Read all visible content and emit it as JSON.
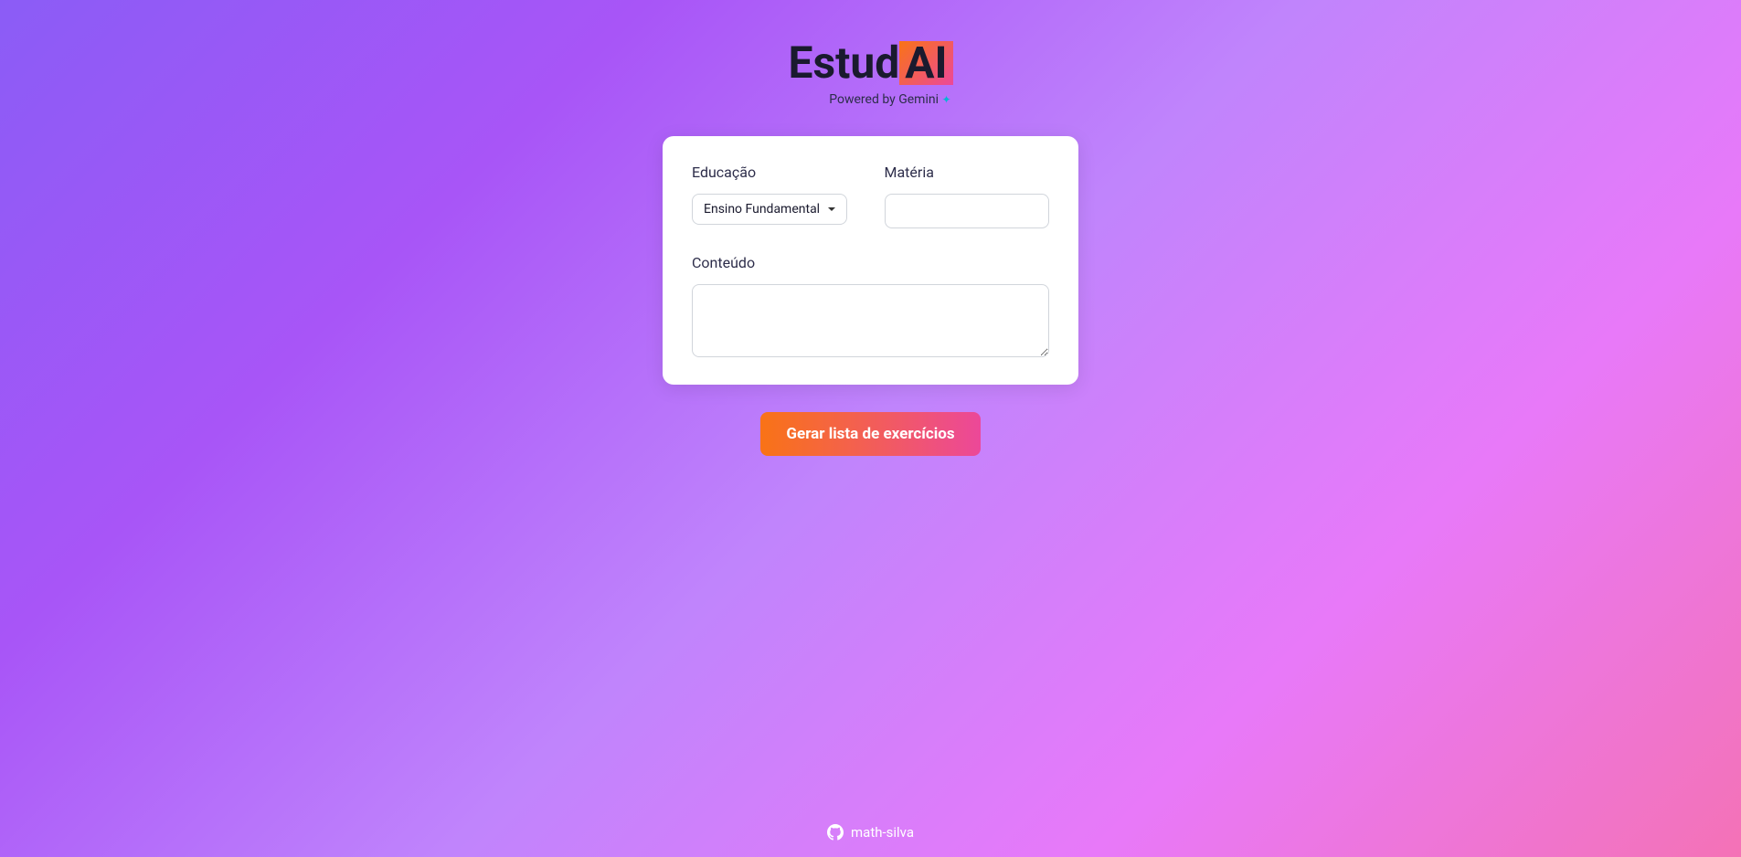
{
  "header": {
    "logo_prefix": "Estud",
    "logo_suffix": "AI",
    "powered_by": "Powered by Gemini"
  },
  "form": {
    "education_label": "Educação",
    "education_selected": "Ensino Fundamental",
    "subject_label": "Matéria",
    "subject_value": "",
    "content_label": "Conteúdo",
    "content_value": ""
  },
  "button": {
    "generate_label": "Gerar lista de exercícios"
  },
  "footer": {
    "author": "math-silva"
  }
}
